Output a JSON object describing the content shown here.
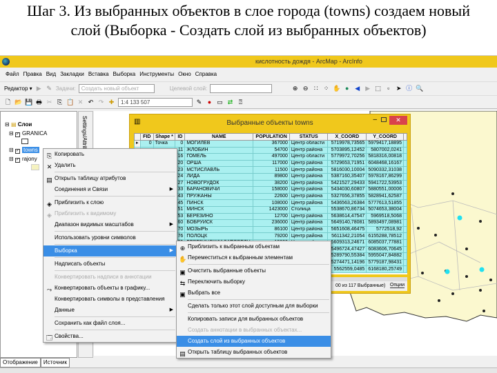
{
  "caption": {
    "line1": "Шаг 3. Из выбранных объектов в слое города (towns) создаем новый",
    "line2": "слой (Выборка - Создать слой из выбранных объектов)"
  },
  "window": {
    "title": "кислотность дождя - ArcMap - ArcInfo"
  },
  "menubar": [
    "Файл",
    "Правка",
    "Вид",
    "Закладки",
    "Вставка",
    "Выборка",
    "Инструменты",
    "Окно",
    "Справка"
  ],
  "toolbar": {
    "editor": "Редактор ▾",
    "task_label": "Задачи:",
    "task_value": "Создать новый объект",
    "target_label": "Целевой слой:",
    "scale": "1:4 133 507"
  },
  "toc": {
    "root": "Слои",
    "layers": [
      "GRANICA",
      "towns",
      "rajony"
    ],
    "vertical_tab": "Settings/Attrib"
  },
  "tabs": [
    "Отображение",
    "Источник"
  ],
  "attr_table": {
    "title": "Выбранные объекты towns",
    "columns": [
      "FID",
      "Shape *",
      "ID",
      "NAME",
      "POPULATION",
      "STATUS",
      "X_COORD",
      "Y_COORD"
    ],
    "rows": [
      [
        "0",
        "Точка",
        "0",
        "МОГИЛЕВ",
        "367000",
        "Центр области",
        "5719978,73565",
        "5979417,18895"
      ],
      [
        "",
        "",
        "11",
        "ЖЛОБИН",
        "54700",
        "Центр района",
        "5703895,12452",
        "5807002,0241"
      ],
      [
        "",
        "",
        "16",
        "ГОМЕЛЬ",
        "497000",
        "Центр области",
        "5779972,70256",
        "5818316,00818"
      ],
      [
        "",
        "",
        "20",
        "ОРША",
        "117000",
        "Центр района",
        "5729653,71951",
        "6048468,16167"
      ],
      [
        "",
        "",
        "23",
        "МСТИСЛАВЛЬ",
        "11500",
        "Центр района",
        "5816030,10004",
        "5090332,31038"
      ],
      [
        "",
        "",
        "24",
        "ЛИДА",
        "89800",
        "Центр района",
        "5387160,35407",
        "5978167,86299"
      ],
      [
        "",
        "",
        "27",
        "НОВОГРУДОК",
        "38200",
        "Центр района",
        "5421527,29433",
        "5941722,53953"
      ],
      [
        "",
        "",
        "33",
        "БАРАНОВИЧИ",
        "158000",
        "Центр района",
        "5434030,60807",
        "5880551,00006"
      ],
      [
        "",
        "",
        "43",
        "ПРУЖАНЫ",
        "22600",
        "Центр района",
        "5327656,37855",
        "5828941,62587"
      ],
      [
        "",
        "",
        "45",
        "ПИНСК",
        "108000",
        "Центр района",
        "5436563,26384",
        "5777613,51855"
      ],
      [
        "",
        "",
        "51",
        "МИНСК",
        "1423000",
        "Столица",
        "5538670,86734",
        "5074653,38004"
      ],
      [
        "",
        "",
        "53",
        "БЕРЕЗИНО",
        "12700",
        "Центр района",
        "5638614,47547",
        "5969518,5068"
      ],
      [
        "",
        "",
        "60",
        "БОБРУЙСК",
        "236000",
        "Центр района",
        "5649140,78081",
        "5893497,08981"
      ],
      [
        "",
        "",
        "70",
        "МОЗЫРЬ",
        "86100",
        "Центр района",
        "5651608,46475",
        "5772518,92"
      ],
      [
        "",
        "",
        "76",
        "ПОЛОЦК",
        "79200",
        "Центр района",
        "5611342,21054",
        "6155288,78512"
      ],
      [
        "",
        "",
        "85",
        "БЕРЕЗИНСКИЙ ЗАПОВЕДН",
        "19300",
        "Центр района",
        "5609313,24671",
        "6085037,77881"
      ],
      [
        "",
        "",
        "",
        "",
        "",
        "на",
        "5496724,47427",
        "6083606,70645"
      ],
      [
        "",
        "",
        "",
        "",
        "",
        "сти",
        "5289790,55384",
        "5955047,84882"
      ],
      [
        "",
        "",
        "",
        "",
        "",
        "сти",
        "5274471,14196",
        "5779187,98431"
      ],
      [
        "",
        "",
        "",
        "",
        "",
        "на",
        "5562559,0485",
        "6168180,25749"
      ]
    ],
    "footer": "00 из 117 Выбранные)",
    "options_button": "Опции"
  },
  "context_menu": [
    {
      "label": "Копировать",
      "icon": "copy-icon"
    },
    {
      "label": "Удалить",
      "icon": "delete-icon"
    },
    {
      "sep": true
    },
    {
      "label": "Открыть таблицу атрибутов",
      "icon": "table-icon"
    },
    {
      "label": "Соединения и Связи",
      "submenu": true
    },
    {
      "sep": true
    },
    {
      "label": "Приблизить к слою",
      "icon": "zoom-layer-icon"
    },
    {
      "label": "Приблизить к видимому",
      "icon": "zoom-visible-icon",
      "disabled": true
    },
    {
      "label": "Диапазон видимых масштабов",
      "submenu": true
    },
    {
      "sep": true
    },
    {
      "label": "Использовать уровни символов"
    },
    {
      "sep": true
    },
    {
      "label": "Выборка",
      "submenu": true,
      "highlight": true
    },
    {
      "sep": true
    },
    {
      "label": "Надписать объекты"
    },
    {
      "sep": true
    },
    {
      "label": "Конвертировать надписи в аннотации",
      "disabled": true
    },
    {
      "label": "Конвертировать объекты в графику...",
      "icon": "convert-graphics-icon"
    },
    {
      "label": "Конвертировать символы в представления"
    },
    {
      "label": "Данные",
      "submenu": true
    },
    {
      "sep": true
    },
    {
      "label": "Сохранить как файл слоя..."
    },
    {
      "sep": true
    },
    {
      "label": "Свойства...",
      "icon": "properties-icon"
    }
  ],
  "selection_submenu": [
    {
      "label": "Приблизить к выбранным объектам",
      "icon": "zoom-selected-icon"
    },
    {
      "label": "Переместиться к выбранным элементам",
      "icon": "pan-selected-icon"
    },
    {
      "sep": true
    },
    {
      "label": "Очистить выбранные объекты",
      "icon": "clear-selection-icon"
    },
    {
      "label": "Переключить выборку",
      "icon": "switch-selection-icon"
    },
    {
      "label": "Выбрать все",
      "icon": "select-all-icon"
    },
    {
      "sep": true
    },
    {
      "label": "Сделать только этот слой доступным для выборки"
    },
    {
      "sep": true
    },
    {
      "label": "Копировать записи для выбранных объектов"
    },
    {
      "label": "Создать аннотации в выбранных объектах...",
      "disabled": true
    },
    {
      "label": "Создать слой из выбранных объектов",
      "highlight": true
    },
    {
      "label": "Открыть таблицу выбранных объектов",
      "icon": "table-icon"
    }
  ],
  "colors": {
    "titlebar": "#f0c81c",
    "highlight": "#3a8ee6",
    "table_selected": "#aaf0f0",
    "map_fill": "#fbf8cf",
    "close": "#d9434b"
  }
}
